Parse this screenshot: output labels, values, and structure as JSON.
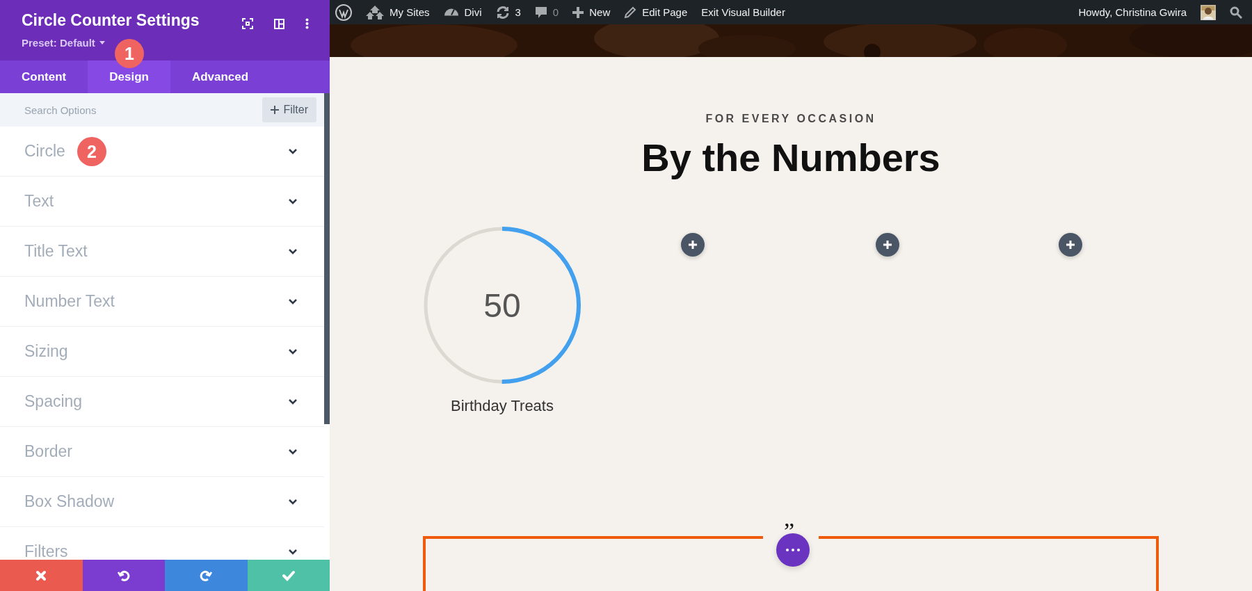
{
  "settings_panel": {
    "title": "Circle Counter Settings",
    "preset": "Preset: Default",
    "header_icons": [
      {
        "kind": "expand"
      },
      {
        "kind": "layout"
      },
      {
        "kind": "more"
      }
    ],
    "tabs": [
      {
        "label": "Content",
        "selected": false
      },
      {
        "label": "Design",
        "selected": true
      },
      {
        "label": "Advanced",
        "selected": false
      }
    ],
    "search": {
      "placeholder": "Search Options"
    },
    "filter_button": "Filter",
    "sections": [
      {
        "label": "Circle",
        "expanded": false
      },
      {
        "label": "Text",
        "expanded": false
      },
      {
        "label": "Title Text",
        "expanded": false
      },
      {
        "label": "Number Text",
        "expanded": false
      },
      {
        "label": "Sizing",
        "expanded": false
      },
      {
        "label": "Spacing",
        "expanded": false
      },
      {
        "label": "Border",
        "expanded": false
      },
      {
        "label": "Box Shadow",
        "expanded": false
      },
      {
        "label": "Filters",
        "expanded": false
      }
    ],
    "annotations": [
      {
        "label": "1"
      },
      {
        "label": "2"
      }
    ],
    "actions": [
      {
        "kind": "discard"
      },
      {
        "kind": "undo"
      },
      {
        "kind": "redo"
      },
      {
        "kind": "save"
      }
    ]
  },
  "admin_bar": {
    "items": [
      {
        "kind": "logo"
      },
      {
        "kind": "sites",
        "label": "My Sites"
      },
      {
        "kind": "divi",
        "label": "Divi"
      },
      {
        "kind": "updates",
        "label": "3"
      },
      {
        "kind": "comments",
        "label": "0"
      },
      {
        "kind": "new",
        "label": "New"
      },
      {
        "kind": "edit",
        "label": "Edit Page"
      },
      {
        "kind": "plain",
        "label": "Exit Visual Builder"
      }
    ],
    "account": "Howdy, Christina Gwira"
  },
  "page": {
    "eyebrow": "FOR EVERY OCCASION",
    "heading": "By the Numbers",
    "counter": {
      "number": "50",
      "title": "Birthday Treats",
      "level": 0.5
    },
    "add_buttons": [
      {
        "kind": "add"
      },
      {
        "kind": "add"
      },
      {
        "kind": "add"
      }
    ],
    "quote_mark": "”"
  }
}
